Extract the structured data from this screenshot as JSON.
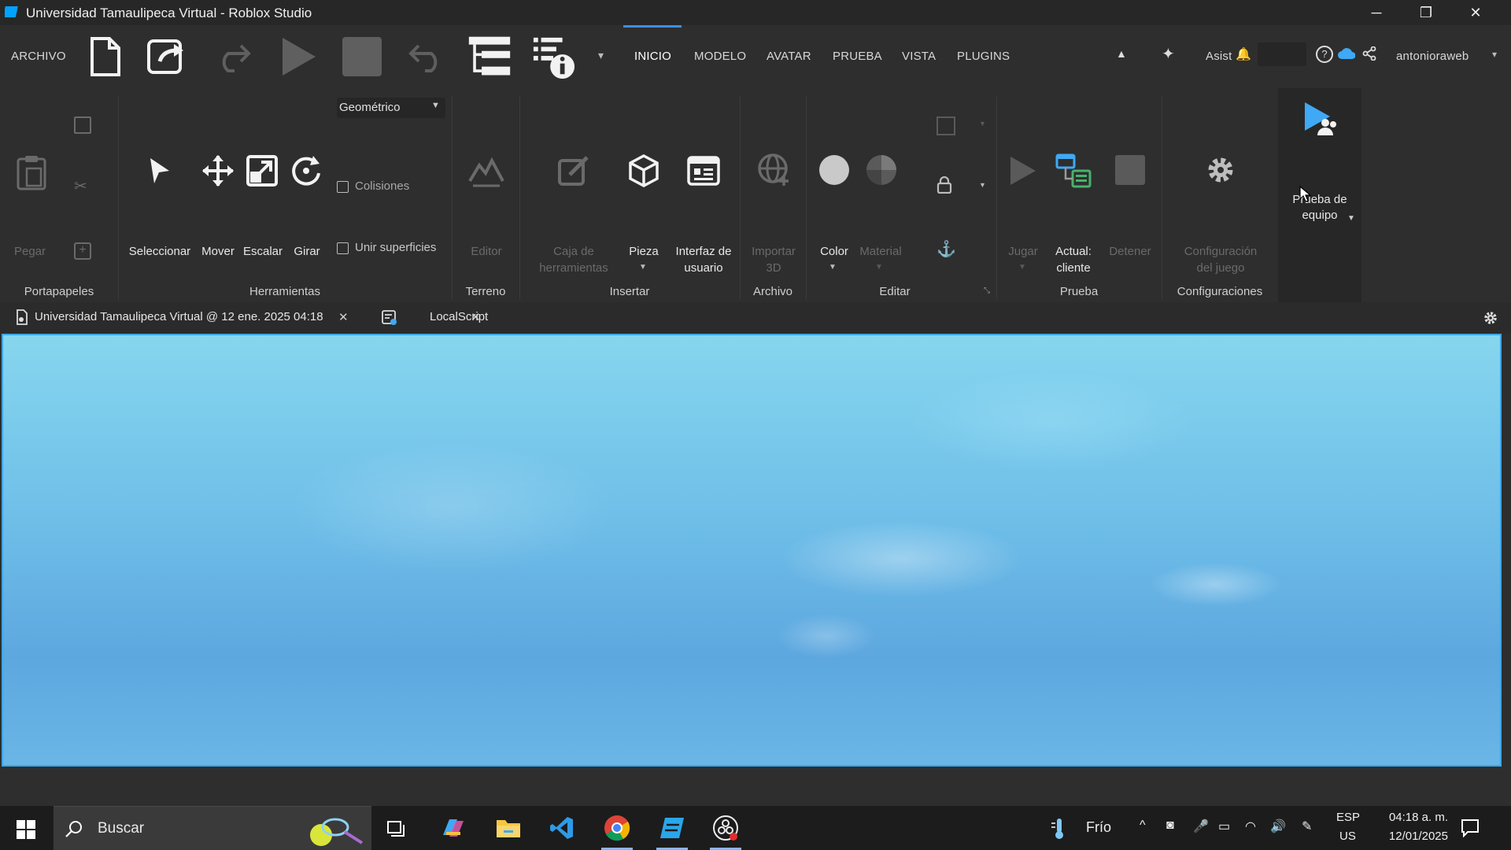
{
  "window": {
    "title": "Universidad Tamaulipeca Virtual - Roblox Studio",
    "min_glyph": "─",
    "restore_glyph": "❐",
    "close_glyph": "✕"
  },
  "menu": {
    "file": "ARCHIVO",
    "tabs": [
      "INICIO",
      "MODELO",
      "AVATAR",
      "PRUEBA",
      "VISTA",
      "PLUGINS"
    ],
    "assistant": "Asist",
    "user": "antonioraweb"
  },
  "ribbon": {
    "geometry_select": "Geométrico",
    "paste": "Pegar",
    "select": "Seleccionar",
    "move": "Mover",
    "scale": "Escalar",
    "rotate": "Girar",
    "collisions": "Colisiones",
    "join_surfaces": "Unir superficies",
    "terrain_editor": "Editor",
    "toolbox_l1": "Caja de",
    "toolbox_l2": "herramientas",
    "part": "Pieza",
    "ui_l1": "Interfaz de",
    "ui_l2": "usuario",
    "import_l1": "Importar",
    "import_l2": "3D",
    "color": "Color",
    "material": "Material",
    "play": "Jugar",
    "current_l1": "Actual:",
    "current_l2": "cliente",
    "stop": "Detener",
    "settings_l1": "Configuración",
    "settings_l2": "del juego",
    "team_l1": "Prueba de",
    "team_l2": "equipo",
    "groups": {
      "clipboard": "Portapapeles",
      "tools": "Herramientas",
      "terrain": "Terreno",
      "insert": "Insertar",
      "file": "Archivo",
      "edit": "Editar",
      "test": "Prueba",
      "settings": "Configuraciones"
    }
  },
  "doc_tabs": [
    {
      "label": "Universidad Tamaulipeca Virtual @ 12 ene. 2025 04:18"
    },
    {
      "label": "LocalScript"
    }
  ],
  "taskbar": {
    "search_placeholder": "Buscar",
    "weather": "Frío",
    "lang_top": "ESP",
    "lang_bottom": "US",
    "time": "04:18 a. m.",
    "date": "12/01/2025"
  }
}
